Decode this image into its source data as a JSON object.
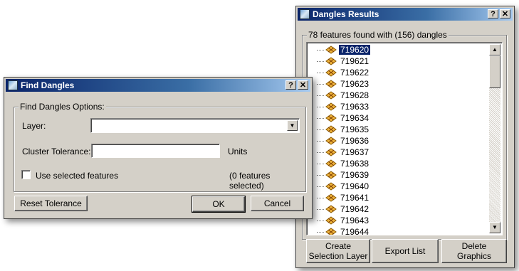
{
  "results_window": {
    "title": "Dangles Results",
    "help_label": "?",
    "close_label": "✕",
    "group_label": "78 features found with (156) dangles",
    "items": [
      "719620",
      "719621",
      "719622",
      "719623",
      "719628",
      "719633",
      "719634",
      "719635",
      "719636",
      "719637",
      "719638",
      "719639",
      "719640",
      "719641",
      "719642",
      "719643",
      "719644"
    ],
    "selected_index": 0,
    "buttons": {
      "create_selection_line1": "Create",
      "create_selection_line2": "Selection Layer",
      "export_list": "Export List",
      "delete_graphics_line1": "Delete",
      "delete_graphics_line2": "Graphics"
    }
  },
  "find_window": {
    "title": "Find Dangles",
    "help_label": "?",
    "close_label": "✕",
    "group_label": "Find Dangles Options:",
    "layer_label": "Layer:",
    "layer_value": "",
    "cluster_label": "Cluster Tolerance:",
    "cluster_value": "",
    "units_label": "Units",
    "use_selected_label": "Use selected features",
    "use_selected_checked": false,
    "features_selected": "(0 features selected)",
    "reset_label": "Reset Tolerance",
    "ok_label": "OK",
    "cancel_label": "Cancel"
  },
  "icons": {
    "app": "map-window-icon",
    "dangle": "dangle-point-icon"
  }
}
